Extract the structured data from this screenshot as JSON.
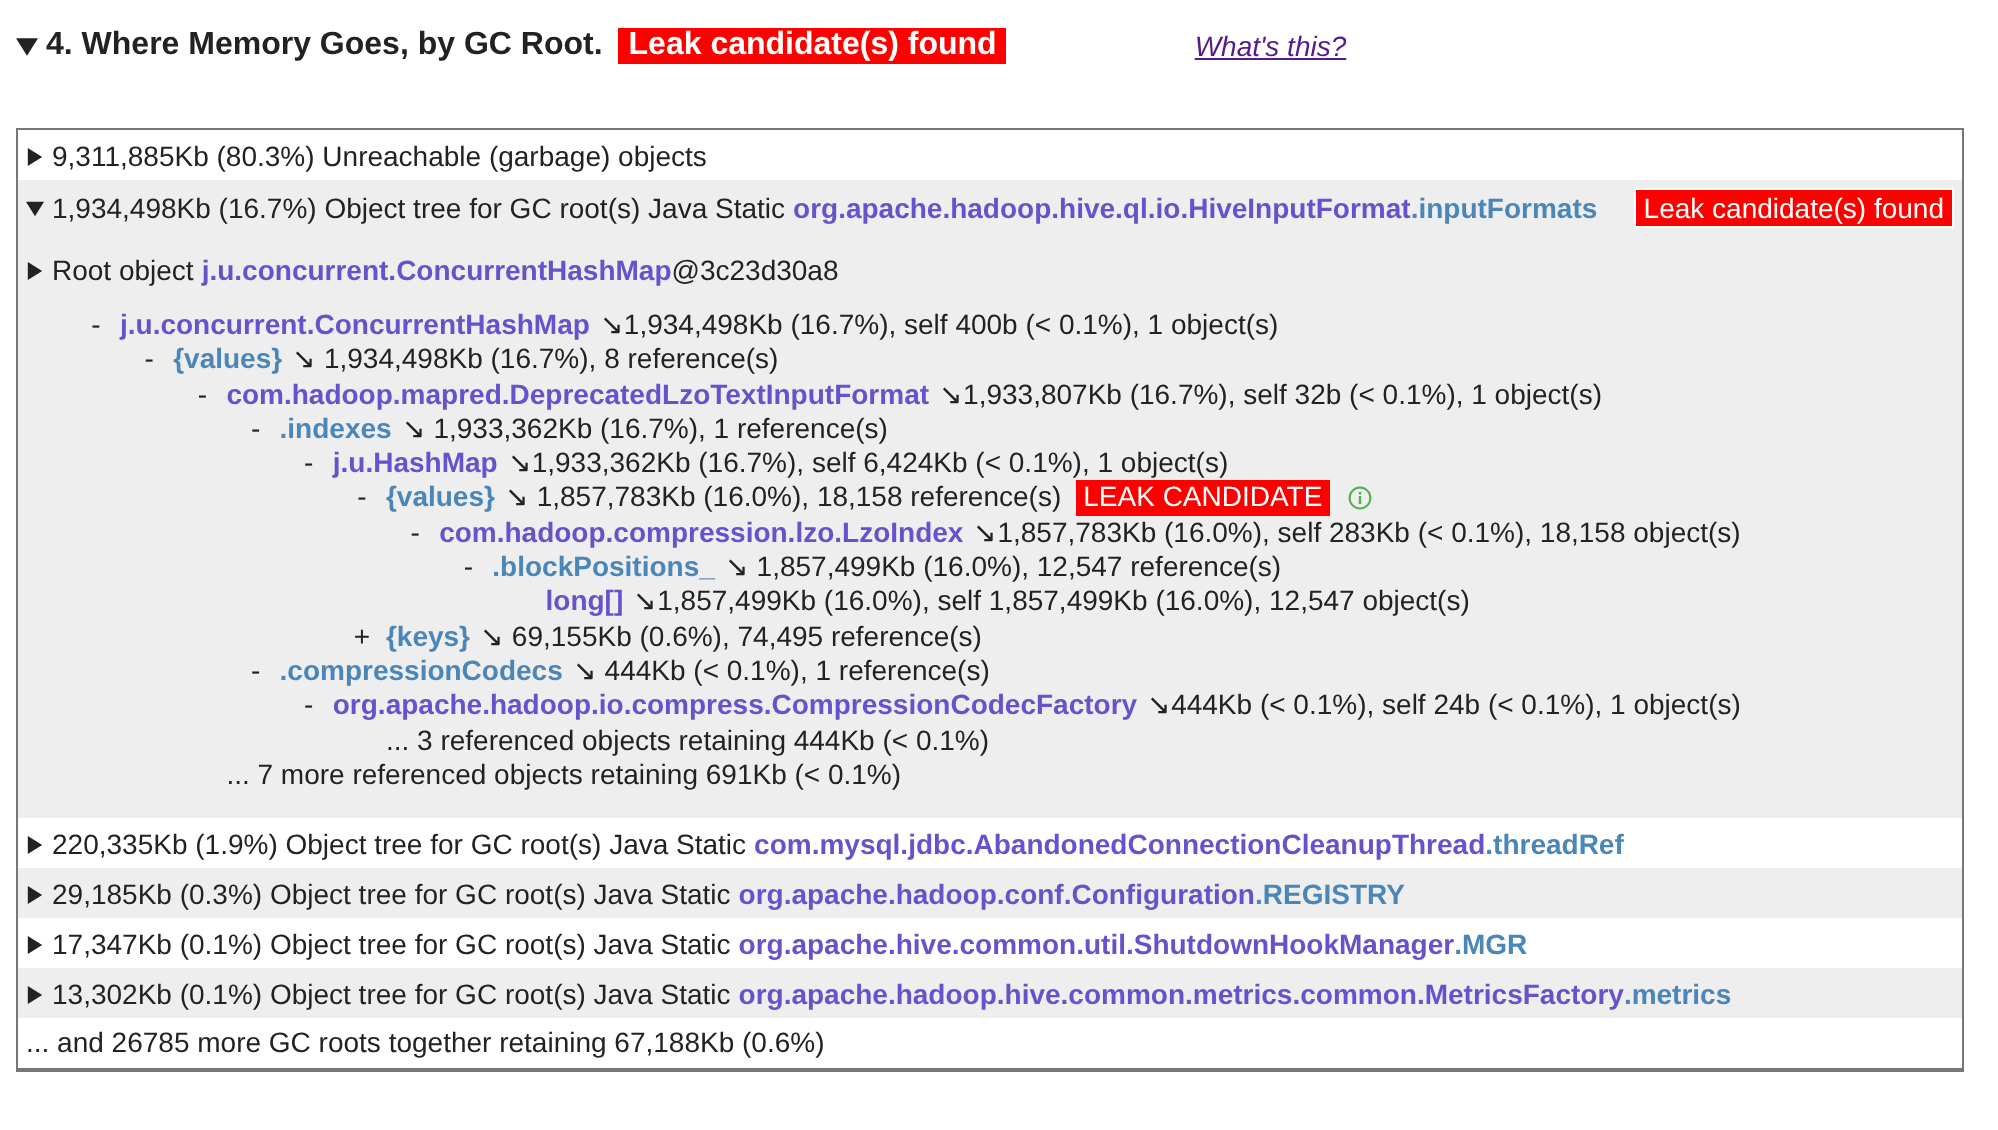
{
  "section": {
    "expanded": true,
    "title": "4. Where Memory Goes, by GC Root.",
    "badge": "Leak candidate(s) found",
    "help_link": "What's this?"
  },
  "roots": [
    {
      "summary": "9,311,885Kb (80.3%) Unreachable (garbage) objects",
      "expanded": false
    },
    {
      "summary": "1,934,498Kb (16.7%) Object tree for GC root(s) Java Static",
      "class": "org.apache.hadoop.hive.ql.io.HiveInputFormat",
      "field": ".inputFormats",
      "badge": "Leak candidate(s) found",
      "expanded": true,
      "root_object": {
        "label": "Root object",
        "class": "j.u.concurrent.ConcurrentHashMap",
        "suffix": "@3c23d30a8"
      },
      "tree": [
        {
          "kind": "class",
          "marker": "-",
          "name": "j.u.concurrent.ConcurrentHashMap",
          "detail": "↘1,934,498Kb (16.7%), self 400b (< 0.1%), 1 object(s)",
          "children": [
            {
              "kind": "field",
              "marker": "-",
              "name": "{values}",
              "detail": "↘ 1,934,498Kb (16.7%), 8 reference(s)",
              "children": [
                {
                  "kind": "class",
                  "marker": "-",
                  "name": "com.hadoop.mapred.DeprecatedLzoTextInputFormat",
                  "detail": "↘1,933,807Kb (16.7%), self 32b (< 0.1%), 1 object(s)",
                  "children": [
                    {
                      "kind": "field",
                      "marker": "-",
                      "name": ".indexes",
                      "detail": "↘ 1,933,362Kb (16.7%), 1 reference(s)",
                      "children": [
                        {
                          "kind": "class",
                          "marker": "-",
                          "name": "j.u.HashMap",
                          "detail": "↘1,933,362Kb (16.7%), self 6,424Kb (< 0.1%), 1 object(s)",
                          "children": [
                            {
                              "kind": "field",
                              "marker": "-",
                              "name": "{values}",
                              "detail": "↘ 1,857,783Kb (16.0%), 18,158 reference(s)",
                              "badge": "LEAK CANDIDATE",
                              "info": true,
                              "children": [
                                {
                                  "kind": "class",
                                  "marker": "-",
                                  "name": "com.hadoop.compression.lzo.LzoIndex",
                                  "detail": "↘1,857,783Kb (16.0%), self 283Kb (< 0.1%), 18,158 object(s)",
                                  "children": [
                                    {
                                      "kind": "field",
                                      "marker": "-",
                                      "name": ".blockPositions_",
                                      "detail": "↘ 1,857,499Kb (16.0%), 12,547 reference(s)",
                                      "children": [
                                        {
                                          "kind": "class",
                                          "name": "long[]",
                                          "detail": "↘1,857,499Kb (16.0%), self 1,857,499Kb (16.0%), 12,547 object(s)"
                                        }
                                      ]
                                    }
                                  ]
                                }
                              ]
                            },
                            {
                              "kind": "field",
                              "marker": "+",
                              "name": "{keys}",
                              "detail": "↘ 69,155Kb (0.6%), 74,495 reference(s)"
                            }
                          ]
                        }
                      ]
                    },
                    {
                      "kind": "field",
                      "marker": "-",
                      "name": ".compressionCodecs",
                      "detail": "↘ 444Kb (< 0.1%), 1 reference(s)",
                      "children": [
                        {
                          "kind": "class",
                          "marker": "-",
                          "name": "org.apache.hadoop.io.compress.CompressionCodecFactory",
                          "detail": "↘444Kb (< 0.1%), self 24b (< 0.1%), 1 object(s)",
                          "children": [
                            {
                              "kind": "more",
                              "text": "... 3 referenced objects retaining 444Kb (< 0.1%)"
                            }
                          ]
                        }
                      ]
                    }
                  ]
                },
                {
                  "kind": "more",
                  "text": "... 7 more referenced objects retaining 691Kb (< 0.1%)"
                }
              ]
            }
          ]
        }
      ]
    },
    {
      "summary": "220,335Kb (1.9%) Object tree for GC root(s) Java Static",
      "class": "com.mysql.jdbc.AbandonedConnectionCleanupThread",
      "field": ".threadRef",
      "expanded": false
    },
    {
      "summary": "29,185Kb (0.3%) Object tree for GC root(s) Java Static",
      "class": "org.apache.hadoop.conf.Configuration",
      "field": ".REGISTRY",
      "expanded": false
    },
    {
      "summary": "17,347Kb (0.1%) Object tree for GC root(s) Java Static",
      "class": "org.apache.hive.common.util.ShutdownHookManager",
      "field": ".MGR",
      "expanded": false
    },
    {
      "summary": "13,302Kb (0.1%) Object tree for GC root(s) Java Static",
      "class": "org.apache.hadoop.hive.common.metrics.common.MetricsFactory",
      "field": ".metrics",
      "expanded": false
    }
  ],
  "footer": "... and 26785 more GC roots together retaining 67,188Kb (0.6%)"
}
